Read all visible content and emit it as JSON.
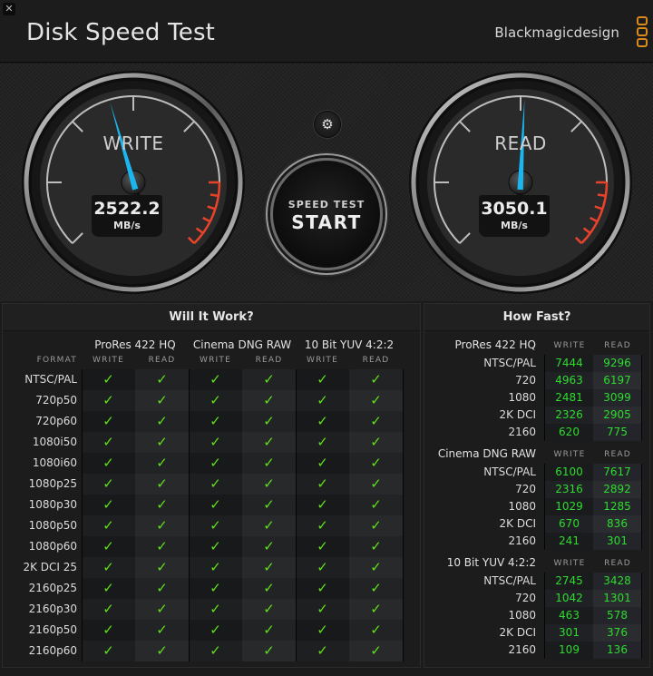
{
  "window": {
    "close_icon": "close-icon",
    "title": "Disk Speed Test",
    "brand": "Blackmagicdesign",
    "brand_logo": "blackmagic-logo-icon",
    "accent_color": "#d98a1a"
  },
  "gauges": {
    "write": {
      "label": "WRITE",
      "value": "2522.2",
      "unit": "MB/s",
      "needle_color": "#1ab6f0",
      "needle_position": 0.44
    },
    "read": {
      "label": "READ",
      "value": "3050.1",
      "unit": "MB/s",
      "needle_color": "#1ab6f0",
      "needle_position": 0.51
    }
  },
  "controls": {
    "settings_icon": "gear-icon",
    "start_sub": "SPEED TEST",
    "start_main": "START"
  },
  "will_it_work": {
    "title": "Will It Work?",
    "format_header": "FORMAT",
    "codecs": [
      "ProRes 422 HQ",
      "Cinema DNG RAW",
      "10 Bit YUV 4:2:2"
    ],
    "write_label": "WRITE",
    "read_label": "READ",
    "check_glyph": "✓",
    "check_color": "#5fe01a",
    "formats": [
      "NTSC/PAL",
      "720p50",
      "720p60",
      "1080i50",
      "1080i60",
      "1080p25",
      "1080p30",
      "1080p50",
      "1080p60",
      "2K DCI 25",
      "2160p25",
      "2160p30",
      "2160p50",
      "2160p60"
    ],
    "results": [
      [
        true,
        true,
        true,
        true,
        true,
        true
      ],
      [
        true,
        true,
        true,
        true,
        true,
        true
      ],
      [
        true,
        true,
        true,
        true,
        true,
        true
      ],
      [
        true,
        true,
        true,
        true,
        true,
        true
      ],
      [
        true,
        true,
        true,
        true,
        true,
        true
      ],
      [
        true,
        true,
        true,
        true,
        true,
        true
      ],
      [
        true,
        true,
        true,
        true,
        true,
        true
      ],
      [
        true,
        true,
        true,
        true,
        true,
        true
      ],
      [
        true,
        true,
        true,
        true,
        true,
        true
      ],
      [
        true,
        true,
        true,
        true,
        true,
        true
      ],
      [
        true,
        true,
        true,
        true,
        true,
        true
      ],
      [
        true,
        true,
        true,
        true,
        true,
        true
      ],
      [
        true,
        true,
        true,
        true,
        true,
        true
      ],
      [
        true,
        true,
        true,
        true,
        true,
        true
      ]
    ]
  },
  "how_fast": {
    "title": "How Fast?",
    "write_label": "WRITE",
    "read_label": "READ",
    "value_color": "#2fdb2f",
    "sections": [
      {
        "codec": "ProRes 422 HQ",
        "rows": [
          {
            "format": "NTSC/PAL",
            "write": "7444",
            "read": "9296"
          },
          {
            "format": "720",
            "write": "4963",
            "read": "6197"
          },
          {
            "format": "1080",
            "write": "2481",
            "read": "3099"
          },
          {
            "format": "2K DCI",
            "write": "2326",
            "read": "2905"
          },
          {
            "format": "2160",
            "write": "620",
            "read": "775"
          }
        ]
      },
      {
        "codec": "Cinema DNG RAW",
        "rows": [
          {
            "format": "NTSC/PAL",
            "write": "6100",
            "read": "7617"
          },
          {
            "format": "720",
            "write": "2316",
            "read": "2892"
          },
          {
            "format": "1080",
            "write": "1029",
            "read": "1285"
          },
          {
            "format": "2K DCI",
            "write": "670",
            "read": "836"
          },
          {
            "format": "2160",
            "write": "241",
            "read": "301"
          }
        ]
      },
      {
        "codec": "10 Bit YUV 4:2:2",
        "rows": [
          {
            "format": "NTSC/PAL",
            "write": "2745",
            "read": "3428"
          },
          {
            "format": "720",
            "write": "1042",
            "read": "1301"
          },
          {
            "format": "1080",
            "write": "463",
            "read": "578"
          },
          {
            "format": "2K DCI",
            "write": "301",
            "read": "376"
          },
          {
            "format": "2160",
            "write": "109",
            "read": "136"
          }
        ]
      }
    ]
  }
}
